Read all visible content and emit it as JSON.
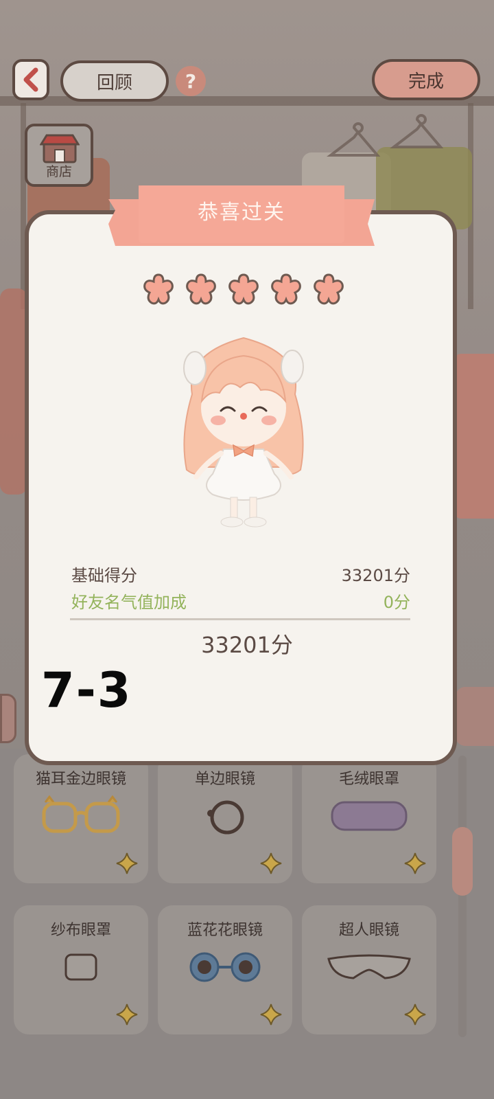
{
  "header": {
    "back_icon": "chevron-left-icon",
    "review_label": "回顾",
    "help_label": "?",
    "done_label": "完成"
  },
  "shop": {
    "label": "商店"
  },
  "modal": {
    "title": "恭喜过关",
    "stars_filled": 5,
    "base_score_label": "基础得分",
    "base_score_value": "33201分",
    "bonus_label": "好友名气值加成",
    "bonus_value": "0分",
    "total": "33201分"
  },
  "overlay": {
    "level_text": "7-3"
  },
  "items": [
    {
      "label": "猫耳金边眼镜",
      "icon": "cat-ear-glasses-icon"
    },
    {
      "label": "单边眼镜",
      "icon": "monocle-icon"
    },
    {
      "label": "毛绒眼罩",
      "icon": "plush-eye-mask-icon"
    },
    {
      "label": "纱布眼罩",
      "icon": "gauze-eye-patch-icon"
    },
    {
      "label": "蓝花花眼镜",
      "icon": "blue-flower-glasses-icon"
    },
    {
      "label": "超人眼镜",
      "icon": "superhero-mask-icon"
    }
  ],
  "colors": {
    "accent_pink": "#f3a594",
    "bonus_green": "#93b35b",
    "frame_brown": "#6e5a51"
  }
}
